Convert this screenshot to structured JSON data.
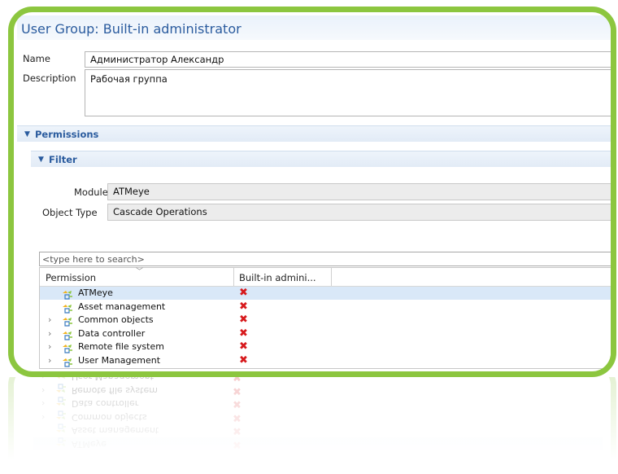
{
  "window": {
    "title": "User Group: Built-in administrator"
  },
  "form": {
    "name_label": "Name",
    "name_value": "Администратор Александр",
    "description_label": "Description",
    "description_value": "Рабочая группа"
  },
  "permissions_section": {
    "label": "Permissions"
  },
  "filter_section": {
    "label": "Filter",
    "module_label": "Module",
    "module_value": "ATMeye",
    "object_type_label": "Object Type",
    "object_type_value": "Cascade Operations"
  },
  "search": {
    "placeholder": "<type here to search>"
  },
  "table": {
    "columns": [
      "Permission",
      "Built-in admini..."
    ],
    "rows": [
      {
        "label": "ATMeye",
        "expandable": false,
        "selected": true,
        "status_icon": "red-x-icon"
      },
      {
        "label": "Asset management",
        "expandable": false,
        "selected": false,
        "status_icon": "red-x-icon"
      },
      {
        "label": "Common objects",
        "expandable": true,
        "selected": false,
        "status_icon": "red-x-icon"
      },
      {
        "label": "Data controller",
        "expandable": true,
        "selected": false,
        "status_icon": "red-x-icon"
      },
      {
        "label": "Remote file system",
        "expandable": true,
        "selected": false,
        "status_icon": "red-x-icon"
      },
      {
        "label": "User Management",
        "expandable": true,
        "selected": false,
        "status_icon": "red-x-icon"
      }
    ]
  },
  "colors": {
    "frame": "#8cc63f",
    "title": "#2a5b9e",
    "selection": "#d9e8f8",
    "deny": "#d7191c"
  },
  "icons": {
    "expand": "chevron-right-icon",
    "permission": "permission-tree-icon",
    "collapse": "triangle-down-icon"
  }
}
